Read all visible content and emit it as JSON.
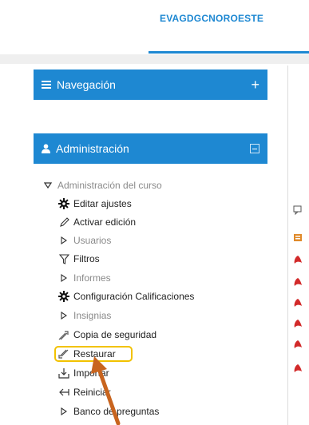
{
  "header": {
    "site_name": "EVAGDGCNOROESTE"
  },
  "navigation_block": {
    "title": "Navegación",
    "toggle": "+"
  },
  "admin_block": {
    "title": "Administración"
  },
  "course_admin": {
    "label": "Administración del curso",
    "items": [
      {
        "label": "Editar ajustes",
        "icon": "gear-icon"
      },
      {
        "label": "Activar edición",
        "icon": "pencil-icon"
      },
      {
        "label": "Usuarios",
        "icon": "triangle-right-icon"
      },
      {
        "label": "Filtros",
        "icon": "filter-icon"
      },
      {
        "label": "Informes",
        "icon": "triangle-right-icon"
      },
      {
        "label": "Configuración Calificaciones",
        "icon": "gear-icon"
      },
      {
        "label": "Insignias",
        "icon": "triangle-right-icon"
      },
      {
        "label": "Copia de seguridad",
        "icon": "backup-icon"
      },
      {
        "label": "Restaurar",
        "icon": "restore-icon"
      },
      {
        "label": "Importar",
        "icon": "import-icon"
      },
      {
        "label": "Reiniciar",
        "icon": "reset-icon"
      },
      {
        "label": "Banco de preguntas",
        "icon": "triangle-right-icon"
      }
    ]
  },
  "colors": {
    "accent": "#1e88d2",
    "highlight": "#f2c200",
    "arrow": "#c8641e"
  }
}
